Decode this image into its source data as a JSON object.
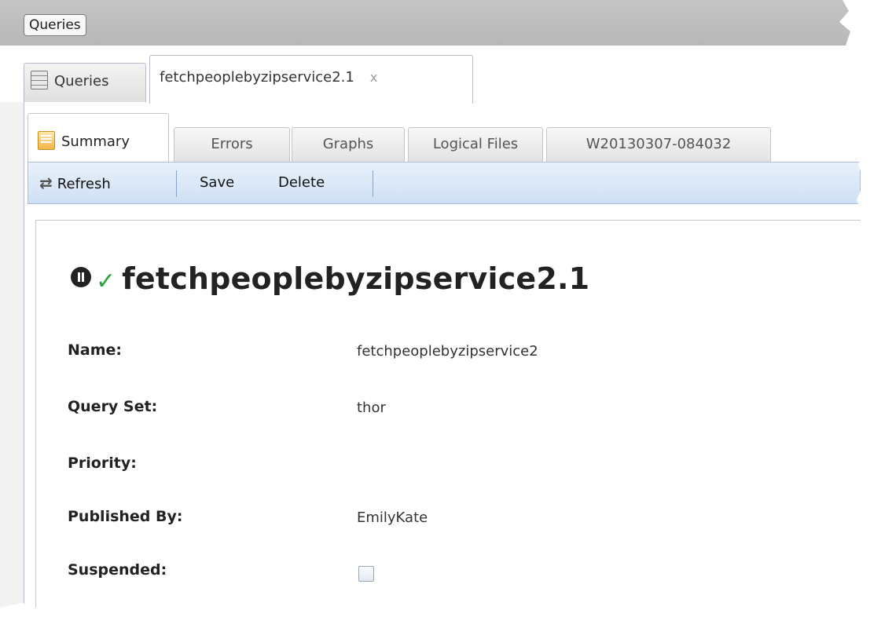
{
  "header": {
    "button_label": "Queries"
  },
  "outer_tabs": {
    "queries_label": "Queries",
    "active_label": "fetchpeoplebyzipservice2.1",
    "close_glyph": "x"
  },
  "inner_tabs": [
    {
      "label": "Summary",
      "active": true
    },
    {
      "label": "Errors"
    },
    {
      "label": "Graphs"
    },
    {
      "label": "Logical Files"
    },
    {
      "label": "W20130307-084032"
    }
  ],
  "toolbar": {
    "refresh_label": "Refresh",
    "save_label": "Save",
    "delete_label": "Delete"
  },
  "summary": {
    "title": "fetchpeoplebyzipservice2.1",
    "status_icons": [
      "pause-icon",
      "check-icon"
    ],
    "fields": {
      "name": {
        "label": "Name:",
        "value": "fetchpeoplebyzipservice2"
      },
      "query_set": {
        "label": "Query Set:",
        "value": "thor"
      },
      "priority": {
        "label": "Priority:",
        "value": ""
      },
      "published_by": {
        "label": "Published By:",
        "value": "EmilyKate"
      },
      "suspended": {
        "label": "Suspended:",
        "checked": false
      }
    }
  },
  "colors": {
    "header_bar": "#bdbdbd",
    "toolbar_bg": "#d8e6f7",
    "check_green": "#2aa13a"
  }
}
